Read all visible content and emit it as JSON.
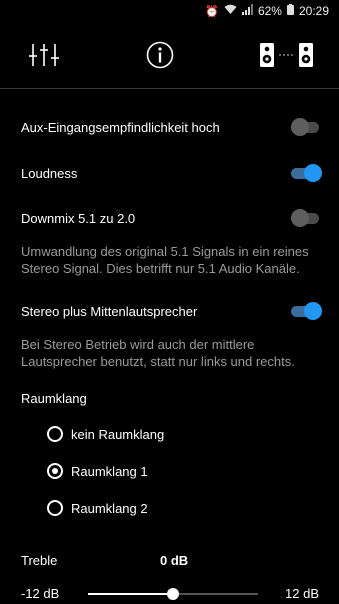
{
  "status_bar": {
    "alarm_icon": "alarm-icon",
    "wifi_icon": "wifi-icon",
    "signal_icon": "signal-icon",
    "battery_percent": "62%",
    "time": "20:29"
  },
  "nav": {
    "items": [
      {
        "icon": "equalizer-icon"
      },
      {
        "icon": "info-icon"
      },
      {
        "icon": "speakers-icon"
      }
    ]
  },
  "settings": {
    "aux_label": "Aux-Eingangsempfindlichkeit hoch",
    "aux_on": false,
    "loudness_label": "Loudness",
    "loudness_on": true,
    "downmix_label": "Downmix 5.1 zu 2.0",
    "downmix_on": false,
    "downmix_desc": "Umwandlung des original 5.1 Signals in ein reines Stereo Signal. Dies betrifft nur 5.1 Audio Kanäle.",
    "stereo_center_label": "Stereo plus Mittenlautsprecher",
    "stereo_center_on": true,
    "stereo_center_desc": "Bei Stereo Betrieb wird auch der mittlere Lautsprecher benutzt, statt nur links und rechts."
  },
  "surround": {
    "title": "Raumklang",
    "options": [
      {
        "label": "kein Raumklang",
        "selected": false
      },
      {
        "label": "Raumklang 1",
        "selected": true
      },
      {
        "label": "Raumklang 2",
        "selected": false
      }
    ]
  },
  "treble": {
    "label": "Treble",
    "value": "0 dB",
    "min_label": "-12 dB",
    "max_label": "12 dB",
    "level_fraction": 0.5
  },
  "colors": {
    "accent": "#2196f3",
    "background": "#000000",
    "secondary_text": "#9a9a9a"
  }
}
